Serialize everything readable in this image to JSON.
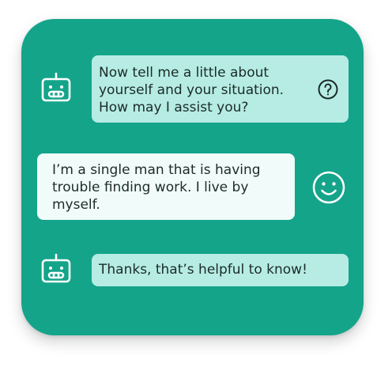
{
  "conversation": {
    "messages": [
      {
        "sender": "bot",
        "avatar_icon": "robot-icon",
        "text": "Now tell me a little about\nyourself and your situation.\nHow may I assist you?",
        "action_icon": "help-circle-icon"
      },
      {
        "sender": "user",
        "avatar_icon": "smiley-face-icon",
        "text": "I’m a single man that is having\ntrouble finding work. I live by\nmyself."
      },
      {
        "sender": "bot",
        "avatar_icon": "robot-icon",
        "text": "Thanks, that’s helpful to know!"
      }
    ]
  },
  "colors": {
    "card_background": "#14a48a",
    "bot_bubble": "#b6ece4",
    "user_bubble": "#f1fcfa",
    "text": "#1b2b28",
    "icon_stroke": "#ffffff",
    "help_icon_stroke": "#1b2b28"
  }
}
